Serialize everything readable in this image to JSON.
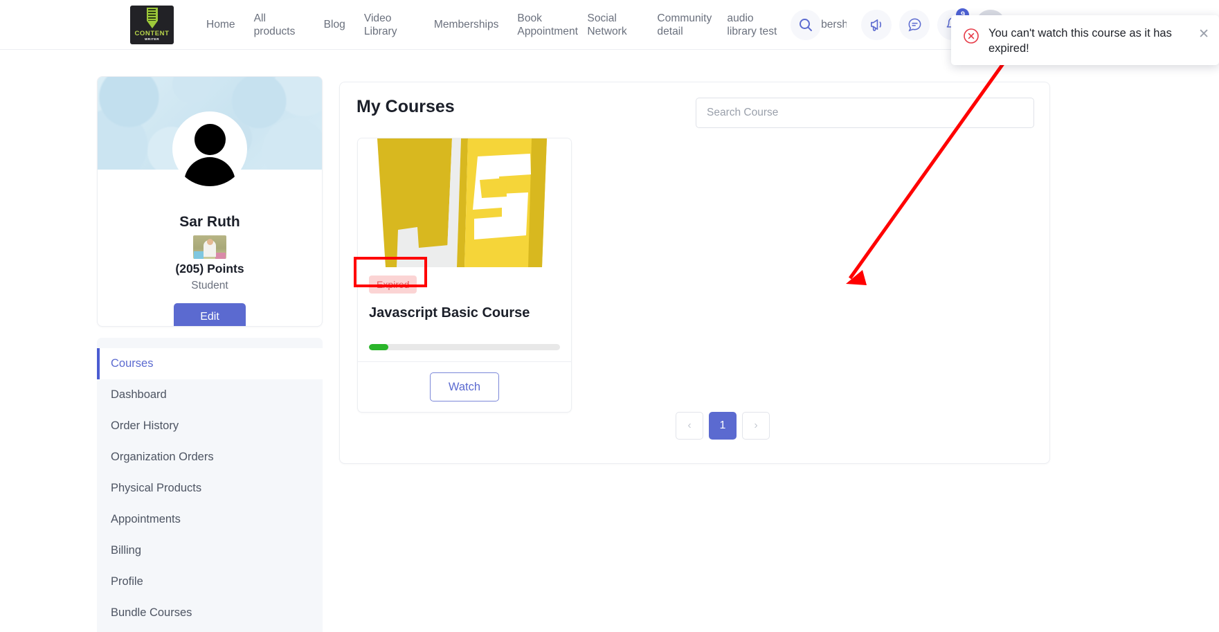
{
  "header": {
    "logo": {
      "line1": "CONTENT",
      "line2": "WRITER",
      "icon": "pen-logo-icon"
    },
    "nav": [
      {
        "label": "Home"
      },
      {
        "label": "All products"
      },
      {
        "label": "Blog"
      },
      {
        "label": "Video Library"
      },
      {
        "label": "Memberships"
      },
      {
        "label": "Book Appointment"
      },
      {
        "label": "Social Network"
      },
      {
        "label": "Community detail"
      },
      {
        "label": "audio library test"
      },
      {
        "label": "membership"
      }
    ],
    "icons": {
      "search": "search-icon",
      "announcement": "megaphone-icon",
      "messages": "chat-bubble-icon",
      "notifications": "bell-icon",
      "notification_count": "9",
      "avatar": "user-avatar-icon"
    }
  },
  "toast": {
    "message": "You can't watch this course as it has expired!",
    "icon": "error-circle-icon",
    "close": "✕",
    "icon_color": "#e63946"
  },
  "profile": {
    "name": "Sar Ruth",
    "points": "(205) Points",
    "role": "Student",
    "edit_label": "Edit",
    "badge_image": "points-badge-image"
  },
  "sidebar": {
    "items": [
      {
        "label": "Courses",
        "active": true
      },
      {
        "label": "Dashboard",
        "active": false
      },
      {
        "label": "Order History",
        "active": false
      },
      {
        "label": "Organization Orders",
        "active": false
      },
      {
        "label": "Physical Products",
        "active": false
      },
      {
        "label": "Appointments",
        "active": false
      },
      {
        "label": "Billing",
        "active": false
      },
      {
        "label": "Profile",
        "active": false
      },
      {
        "label": "Bundle Courses",
        "active": false
      }
    ]
  },
  "main": {
    "title": "My Courses",
    "search_placeholder": "Search Course",
    "search_value": "",
    "course": {
      "status_badge": "Expired",
      "title": "Javascript Basic Course",
      "progress_percent": 10,
      "watch_label": "Watch",
      "thumbnail": "javascript-logo-image"
    },
    "pagination": {
      "prev": "‹",
      "current": "1",
      "next": "›"
    }
  },
  "annotations": {
    "highlight_target": "Expired",
    "arrow_color": "#ff0000"
  },
  "colors": {
    "accent": "#5b6ad0",
    "danger": "#e2565b",
    "progress": "#2ab52a",
    "badge_bg": "#fbd4d4",
    "annotation": "#ff0000"
  }
}
